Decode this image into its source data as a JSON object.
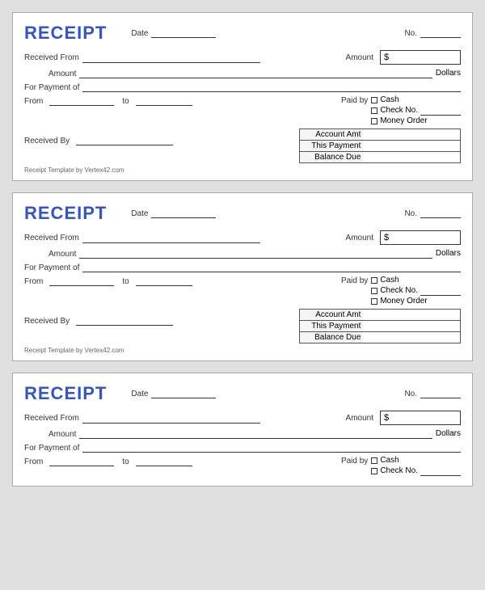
{
  "receipts": [
    {
      "id": "receipt-1",
      "title": "RECEIPT",
      "date_label": "Date",
      "no_label": "No.",
      "received_from_label": "Received From",
      "amount_label": "Amount",
      "dollar_sign": "$",
      "amount_word_label": "Amount",
      "dollars_label": "Dollars",
      "for_payment_label": "For Payment of",
      "from_label": "From",
      "to_label": "to",
      "paid_by_label": "Paid by",
      "options": [
        "[ ]  Cash",
        "[ ]  Check No.",
        "[ ]  Money Order"
      ],
      "received_by_label": "Received By",
      "account_amt_label": "Account Amt",
      "this_payment_label": "This Payment",
      "balance_due_label": "Balance Due",
      "footer": "Receipt Template by Vertex42.com"
    },
    {
      "id": "receipt-2",
      "title": "RECEIPT",
      "date_label": "Date",
      "no_label": "No.",
      "received_from_label": "Received From",
      "amount_label": "Amount",
      "dollar_sign": "$",
      "amount_word_label": "Amount",
      "dollars_label": "Dollars",
      "for_payment_label": "For Payment of",
      "from_label": "From",
      "to_label": "to",
      "paid_by_label": "Paid by",
      "options": [
        "[ ]  Cash",
        "[ ]  Check No.",
        "[ ]  Money Order"
      ],
      "received_by_label": "Received By",
      "account_amt_label": "Account Amt",
      "this_payment_label": "This Payment",
      "balance_due_label": "Balance Due",
      "footer": "Receipt Template by Vertex42.com"
    },
    {
      "id": "receipt-3",
      "title": "RECEIPT",
      "date_label": "Date",
      "no_label": "No.",
      "received_from_label": "Received From",
      "amount_label": "Amount",
      "dollar_sign": "$",
      "amount_word_label": "Amount",
      "dollars_label": "Dollars",
      "for_payment_label": "For Payment of",
      "from_label": "From",
      "to_label": "to",
      "paid_by_label": "Paid by",
      "options": [
        "[ ]  Cash",
        "[ ]  Check No."
      ],
      "footer": ""
    }
  ]
}
